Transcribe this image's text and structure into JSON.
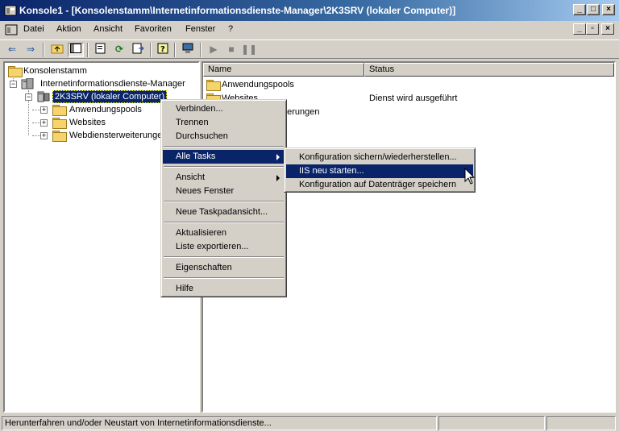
{
  "window": {
    "title": "Konsole1 - [Konsolenstamm\\Internetinformationsdienste-Manager\\2K3SRV (lokaler Computer)]"
  },
  "menubar": {
    "items": [
      "Datei",
      "Aktion",
      "Ansicht",
      "Favoriten",
      "Fenster",
      "?"
    ]
  },
  "tree": {
    "root": "Konsolenstamm",
    "manager": "Internetinformationsdienste-Manager",
    "server": "2K3SRV (lokaler Computer)",
    "children": [
      "Anwendungspools",
      "Websites",
      "Webdiensterweiterungen"
    ]
  },
  "list": {
    "columns": [
      "Name",
      "Status"
    ],
    "rows": [
      {
        "name": "Anwendungspools",
        "status": ""
      },
      {
        "name": "Websites",
        "status": "Dienst wird ausgeführt"
      },
      {
        "name": "Webdiensterweiterungen",
        "status": ""
      }
    ]
  },
  "context_menu": {
    "items": [
      "Verbinden...",
      "Trennen",
      "Durchsuchen",
      "Alle Tasks",
      "Ansicht",
      "Neues Fenster",
      "Neue Taskpadansicht...",
      "Aktualisieren",
      "Liste exportieren...",
      "Eigenschaften",
      "Hilfe"
    ],
    "highlighted": "Alle Tasks"
  },
  "submenu": {
    "items": [
      "Konfiguration sichern/wiederherstellen...",
      "IIS neu starten...",
      "Konfiguration auf Datenträger speichern"
    ],
    "highlighted": "IIS neu starten..."
  },
  "statusbar": {
    "text": "Herunterfahren und/oder Neustart von Internetinformationsdienste..."
  },
  "colors": {
    "selection": "#0a246a",
    "face": "#d4d0c8"
  }
}
